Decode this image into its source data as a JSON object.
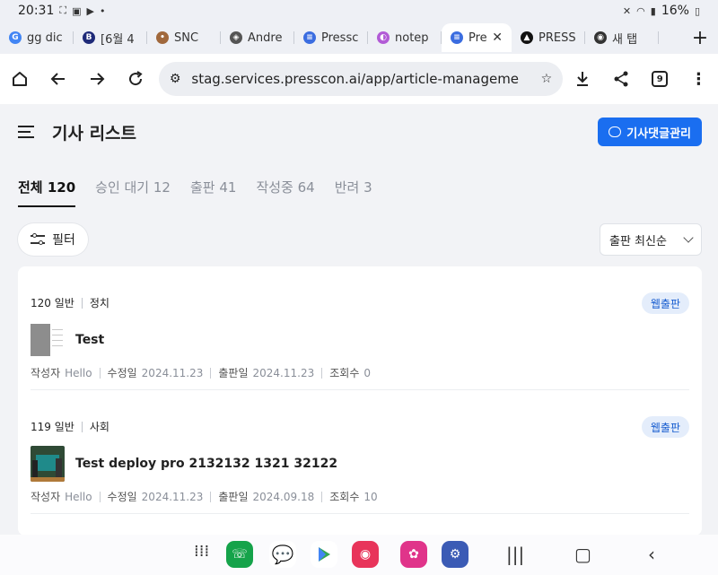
{
  "status": {
    "time": "20:31",
    "dot": "•",
    "battery": "16%"
  },
  "tabs": [
    {
      "label": "gg dic",
      "fav": "G",
      "color": "#4285f4"
    },
    {
      "label": "[6월 4",
      "fav": "B",
      "color": "#1e2a78"
    },
    {
      "label": "SNC",
      "fav": "•",
      "color": "#a0683c"
    },
    {
      "label": "Andre",
      "fav": "◈",
      "color": "#555555"
    },
    {
      "label": "Pressc",
      "fav": "≡",
      "color": "#3b6de0"
    },
    {
      "label": "notep",
      "fav": "◐",
      "color": "#b25bd6"
    },
    {
      "label": "Pre",
      "fav": "≡",
      "color": "#3b6de0",
      "active": true,
      "close": "✕"
    },
    {
      "label": "PRESS",
      "fav": "▲",
      "color": "#111111"
    },
    {
      "label": "새 탭",
      "fav": "◉",
      "color": "#333333"
    }
  ],
  "newtab": "+",
  "toolbar": {
    "url": "stag.services.presscon.ai/app/article-manageme",
    "tab_count": "9"
  },
  "page": {
    "title": "기사 리스트",
    "comment_btn": "기사댓글관리",
    "tabs": [
      {
        "label": "전체 120",
        "active": true
      },
      {
        "label": "승인 대기 12"
      },
      {
        "label": "출판 41"
      },
      {
        "label": "작성중 64"
      },
      {
        "label": "반려 3"
      }
    ],
    "filter": "필터",
    "sort": "출판 최신순",
    "labels": {
      "author": "작성자",
      "modified": "수정일",
      "published": "출판일",
      "views": "조회수"
    },
    "articles": [
      {
        "id": "120",
        "type": "일반",
        "category": "정치",
        "badge": "웹출판",
        "title": "Test",
        "author": "Hello",
        "modified": "2024.11.23",
        "published": "2024.11.23",
        "views": "0"
      },
      {
        "id": "119",
        "type": "일반",
        "category": "사회",
        "badge": "웹출판",
        "title": "Test deploy pro 2132132 1321 32122",
        "author": "Hello",
        "modified": "2024.11.23",
        "published": "2024.09.18",
        "views": "10"
      }
    ]
  },
  "colors": {
    "primary": "#1a6ef0",
    "badge_bg": "#e4edfb",
    "badge_text": "#1a5fd0"
  }
}
